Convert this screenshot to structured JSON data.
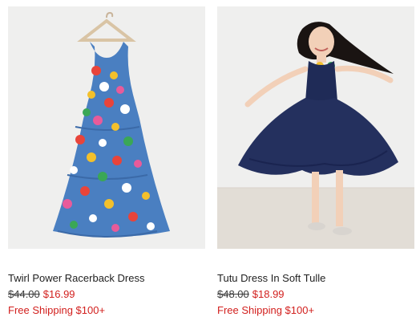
{
  "products": [
    {
      "name": "Twirl Power Racerback Dress",
      "original_price": "$44.00",
      "sale_price": "$16.99",
      "shipping": "Free Shipping $100+",
      "image_icon": "dress-on-hanger-photo"
    },
    {
      "name": "Tutu Dress In Soft Tulle",
      "original_price": "$48.00",
      "sale_price": "$18.99",
      "shipping": "Free Shipping $100+",
      "image_icon": "girl-twirling-dress-photo"
    }
  ],
  "colors": {
    "sale": "#d2201e",
    "image_bg": "#efefee",
    "dress_blue": "#4a7fc1",
    "tutu_navy": "#1f2b57"
  }
}
